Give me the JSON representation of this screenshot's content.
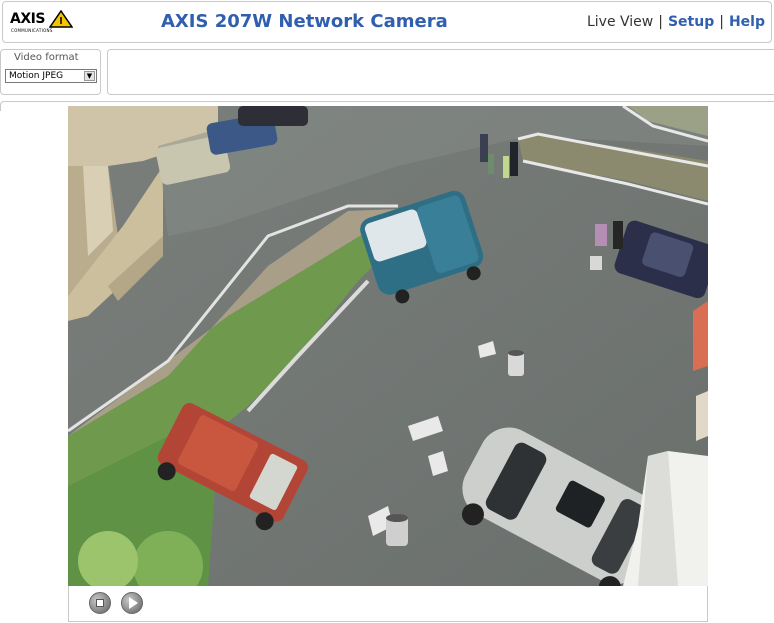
{
  "header": {
    "logo_text": "AXIS",
    "logo_subtext": "COMMUNICATIONS",
    "title": "AXIS 207W Network Camera",
    "nav": {
      "live_view": "Live View",
      "setup": "Setup",
      "help": "Help",
      "separator": "|"
    }
  },
  "video_format": {
    "label": "Video format",
    "selected": "Motion JPEG"
  },
  "colors": {
    "title_blue": "#2f5fae",
    "logo_yellow": "#f2c500",
    "border_gray": "#c9c9c9"
  },
  "icons": {
    "stop": "stop-icon",
    "play": "play-icon",
    "dropdown": "chevron-down-icon"
  }
}
